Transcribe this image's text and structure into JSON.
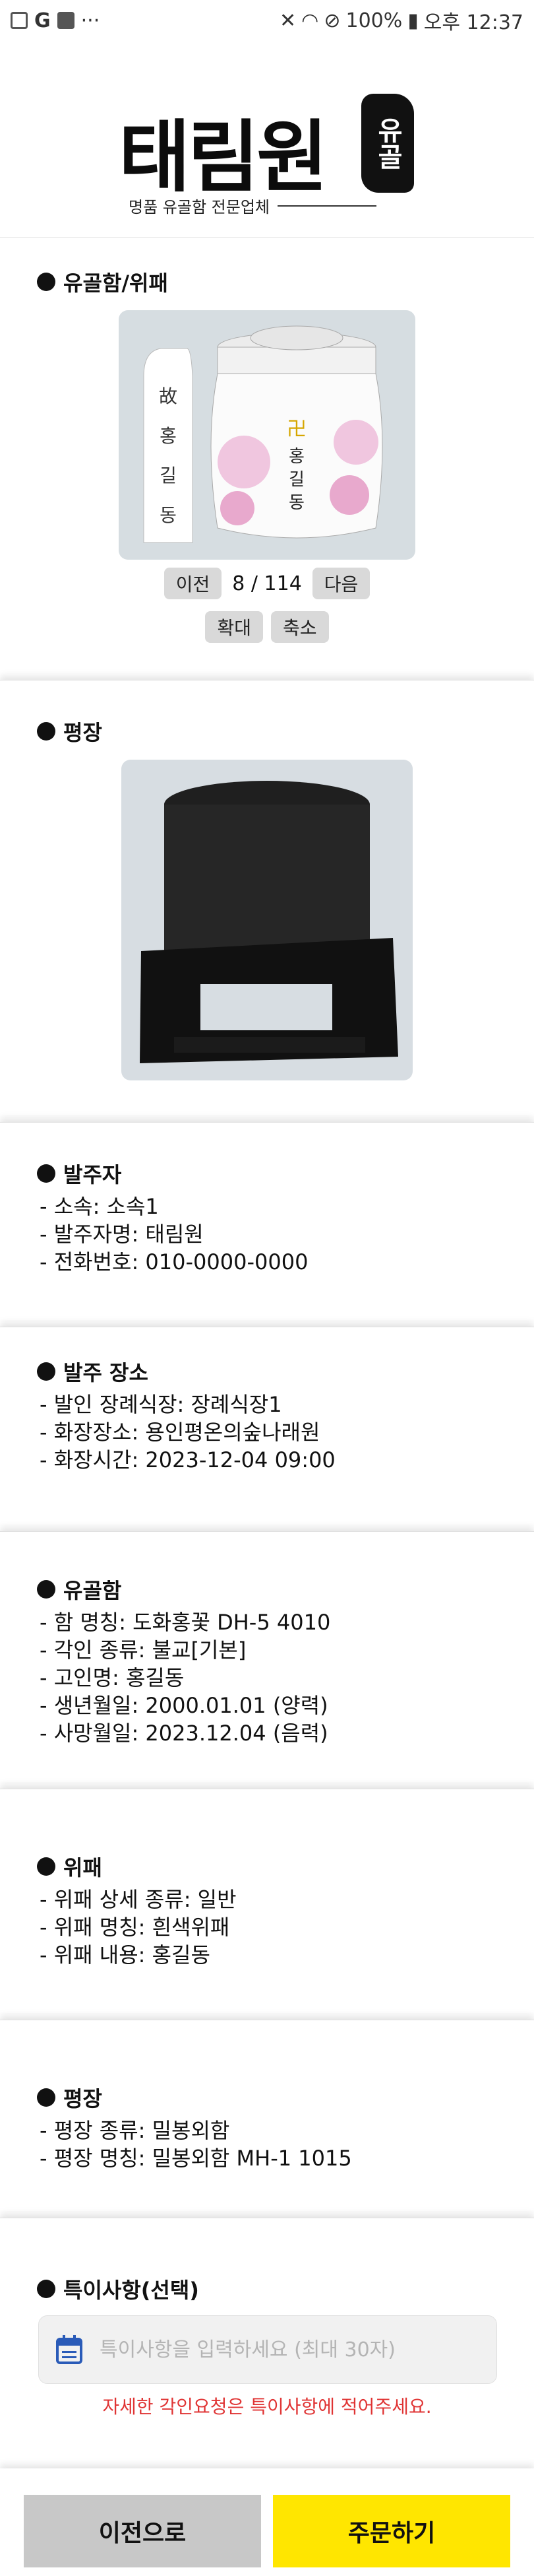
{
  "status_bar": {
    "left_glyph": "G",
    "more": "···",
    "battery": "100%",
    "time": "오후 12:37"
  },
  "header": {
    "logo_text": "태림원",
    "logo_seal": "유골",
    "logo_sub": "명품 유골함 전문업체"
  },
  "urn_plaque": {
    "title": "유골함/위패",
    "plaque_text": "故 홍 길 동",
    "urn_name": "홍길동",
    "prev_label": "이전",
    "page_current": "8",
    "page_separator": "/",
    "page_total": "114",
    "next_label": "다음",
    "zoom_in_label": "확대",
    "zoom_out_label": "축소"
  },
  "platform": {
    "title": "평장"
  },
  "orderer": {
    "title": "발주자",
    "lines": [
      "- 소속: 소속1",
      "- 발주자명: 태림원",
      "- 전화번호: 010-0000-0000"
    ]
  },
  "order_place": {
    "title": "발주 장소",
    "lines": [
      "- 발인 장례식장: 장례식장1",
      "- 화장장소: 용인평온의숲나래원",
      "- 화장시간: 2023-12-04 09:00"
    ]
  },
  "urn": {
    "title": "유골함",
    "lines": [
      "- 함 명칭: 도화홍꽃 DH-5 4010",
      "- 각인 종류: 불교[기본]",
      "- 고인명: 홍길동",
      "- 생년월일: 2000.01.01 (양력)",
      "- 사망월일: 2023.12.04 (음력)"
    ]
  },
  "tablet": {
    "title": "위패",
    "lines": [
      "- 위패 상세 종류: 일반",
      "- 위패 명칭: 흰색위패",
      "- 위패 내용: 홍길동"
    ]
  },
  "platform_info": {
    "title": "평장",
    "lines": [
      "- 평장 종류: 밀봉외함",
      "- 평장 명칭: 밀봉외함 MH-1 1015"
    ]
  },
  "notes": {
    "title": "특이사항(선택)",
    "placeholder": "특이사항을 입력하세요 (최대 30자)",
    "hint": "자세한 각인요청은 특이사항에 적어주세요."
  },
  "footer": {
    "prev_button": "이전으로",
    "order_button": "주문하기"
  },
  "colors": {
    "order_button": "#ffe600",
    "prev_button": "#c8c8c8",
    "hint": "#e03434"
  }
}
